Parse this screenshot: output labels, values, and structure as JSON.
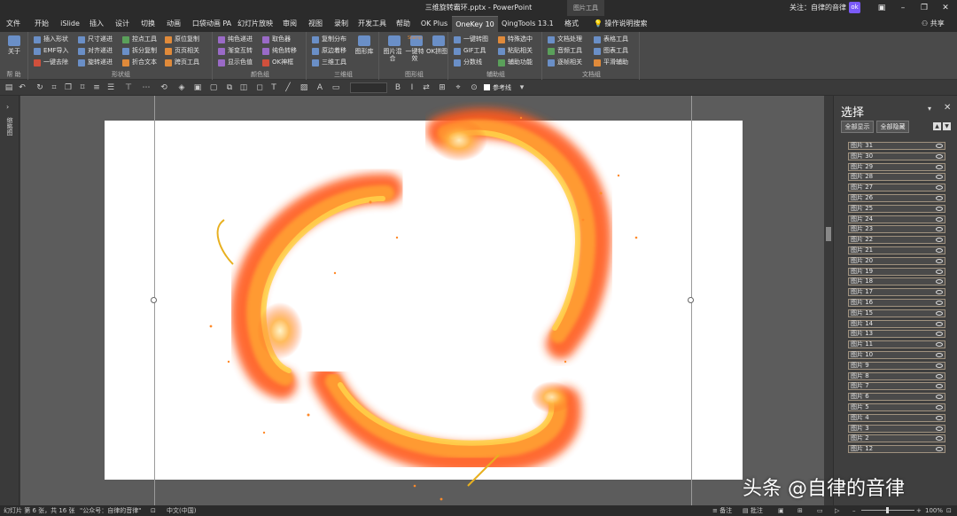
{
  "window": {
    "title": "三维旋转霸环.pptx  -  PowerPoint",
    "picture_tools": "图片工具",
    "follow": "关注：自律的音律",
    "avatar": "ok"
  },
  "tabs": [
    {
      "label": "文件"
    },
    {
      "label": "开始"
    },
    {
      "label": "iSlide"
    },
    {
      "label": "插入"
    },
    {
      "label": "设计"
    },
    {
      "label": "切换"
    },
    {
      "label": "动画"
    },
    {
      "label": "口袋动画 PA"
    },
    {
      "label": "幻灯片放映"
    },
    {
      "label": "审阅"
    },
    {
      "label": "视图"
    },
    {
      "label": "录制"
    },
    {
      "label": "开发工具"
    },
    {
      "label": "帮助"
    },
    {
      "label": "OK Plus"
    },
    {
      "label": "OneKey 10"
    },
    {
      "label": "QingTools 13.1"
    },
    {
      "label": "格式"
    }
  ],
  "search_ops": "操作说明搜索",
  "share": "共享",
  "ribbon": {
    "help": {
      "about": "关于",
      "label": "帮 助"
    },
    "shape_group": {
      "label": "形状组",
      "buttons": [
        "插入形状",
        "EMF导入",
        "一键去除",
        "尺寸递进",
        "对齐递进",
        "旋转递进",
        "控点工具",
        "拆分复制",
        "折合文本",
        "原位复制",
        "页页相关",
        "跨页工具"
      ]
    },
    "color_group": {
      "label": "颜色组",
      "buttons": [
        "纯色递进",
        "渐变互转",
        "显示色值",
        "取色器",
        "纯色转移",
        "OK神框"
      ]
    },
    "three_d_group": {
      "label": "三维组",
      "buttons": [
        "复制分布",
        "原边着移",
        "三维工具"
      ],
      "big": "图形库"
    },
    "image_group": {
      "label": "图形组",
      "big": [
        "图片混合",
        "一键特效",
        "OK拼图"
      ],
      "badge": "Stamp"
    },
    "assist_group": {
      "label": "辅助组",
      "buttons": [
        "一键转图",
        "GIF工具",
        "分数线",
        "特殊选中",
        "粘贴相关",
        "辅助功能"
      ]
    },
    "doc_group": {
      "label": "文档组",
      "buttons": [
        "文档处理",
        "音频工具",
        "逐帧相关",
        "表格工具",
        "图表工具",
        "平滑辅助"
      ]
    }
  },
  "quickbar": {
    "guide_label": "参考线"
  },
  "left_pane": {
    "label": "缩略图"
  },
  "selection_pane": {
    "title": "选择",
    "show_all": "全部显示",
    "hide_all": "全部隐藏",
    "items": [
      "图片 31",
      "图片 30",
      "图片 29",
      "图片 28",
      "图片 27",
      "图片 26",
      "图片 25",
      "图片 24",
      "图片 23",
      "图片 22",
      "图片 21",
      "图片 20",
      "图片 19",
      "图片 18",
      "图片 17",
      "图片 16",
      "图片 15",
      "图片 14",
      "图片 13",
      "图片 11",
      "图片 10",
      "图片 9",
      "图片 8",
      "图片 7",
      "图片 6",
      "图片 5",
      "图片 4",
      "图片 3",
      "图片 2",
      "图片 12"
    ]
  },
  "status": {
    "slide_info": "幻灯片 第 6 张，共 16 张",
    "public_account": "\"公众号：自律的音律\"",
    "language": "中文(中国)",
    "notes": "备注",
    "comments": "批注",
    "zoom": "100%"
  },
  "watermark": "头条 @自律的音律",
  "colors": {
    "fire_outer": "#ff5a1a",
    "fire_mid": "#ff8a2a",
    "fire_core": "#ffd24a",
    "accent_purple": "#7a5af8"
  }
}
